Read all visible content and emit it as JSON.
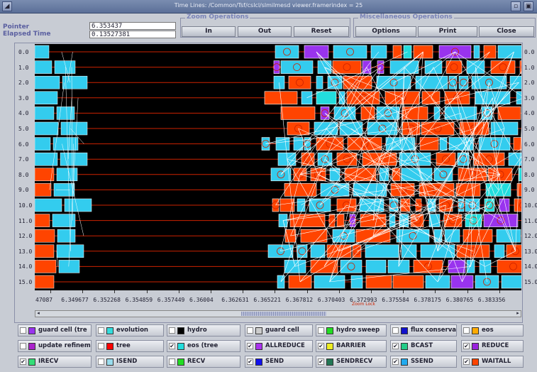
{
  "window": {
    "title": "Time Lines: /Common/Tsf/cslcl/slmilmesd viewer.framerindex = 25"
  },
  "pointer": {
    "label": "Pointer",
    "value": "6.353437"
  },
  "elapsed": {
    "label": "Elapsed Time",
    "value": "0.13527381"
  },
  "zoom": {
    "title": "Zoom Operations",
    "in": "In",
    "out": "Out",
    "reset": "Reset"
  },
  "misc": {
    "title": "Miscellaneous Operations",
    "options": "Options",
    "print": "Print",
    "close": "Close"
  },
  "processes": [
    "0.0",
    "1.0",
    "2.0",
    "3.0",
    "4.0",
    "5.0",
    "6.0",
    "7.0",
    "8.0",
    "9.0",
    "10.0",
    "11.0",
    "12.0",
    "13.0",
    "14.0",
    "15.0"
  ],
  "xaxis": {
    "ticks": [
      "47087",
      "6.349677",
      "6.352268",
      "6.354859",
      "6.357449",
      "6.36004",
      "6.362631",
      "6.365221",
      "6.367812",
      "6.370403",
      "6.372993",
      "6.375584",
      "6.378175",
      "6.380765",
      "6.383356"
    ],
    "zoom_lock": "Zoom Lock"
  },
  "colors": {
    "background": "#000000",
    "timeline": "#cc2200",
    "recv": "#ff4400",
    "send": "#33ccee",
    "hydro": "#9933ee",
    "arrow": "#ffffff"
  },
  "legend": [
    {
      "label": "guard cell (tre",
      "color": "#9933ee",
      "checked": false
    },
    {
      "label": "evolution",
      "color": "#33dddd",
      "checked": false
    },
    {
      "label": "hydro",
      "color": "#000000",
      "checked": false
    },
    {
      "label": "guard cell",
      "color": "#cccccc",
      "checked": false
    },
    {
      "label": "hydro sweep",
      "color": "#22dd22",
      "checked": false
    },
    {
      "label": "flux conservati",
      "color": "#1111cc",
      "checked": false
    },
    {
      "label": "eos",
      "color": "#ffaa00",
      "checked": false
    },
    {
      "label": "update refineme",
      "color": "#aa22cc",
      "checked": false
    },
    {
      "label": "tree",
      "color": "#ff0000",
      "checked": false
    },
    {
      "label": "eos (tree",
      "color": "#22dddd",
      "checked": true
    },
    {
      "label": "ALLREDUCE",
      "color": "#aa33ee",
      "checked": true
    },
    {
      "label": "BARRIER",
      "color": "#eeee22",
      "checked": true
    },
    {
      "label": "BCAST",
      "color": "#22cc88",
      "checked": true
    },
    {
      "label": "REDUCE",
      "color": "#9922dd",
      "checked": true
    },
    {
      "label": "IRECV",
      "color": "#33dd77",
      "checked": true
    },
    {
      "label": "ISEND",
      "color": "#99ddee",
      "checked": false
    },
    {
      "label": "RECV",
      "color": "#22dd22",
      "checked": false
    },
    {
      "label": "SEND",
      "color": "#1111ee",
      "checked": true
    },
    {
      "label": "SENDRECV",
      "color": "#227755",
      "checked": true
    },
    {
      "label": "SSEND",
      "color": "#22aaee",
      "checked": true
    },
    {
      "label": "WAITALL",
      "color": "#ff4400",
      "checked": true
    }
  ]
}
